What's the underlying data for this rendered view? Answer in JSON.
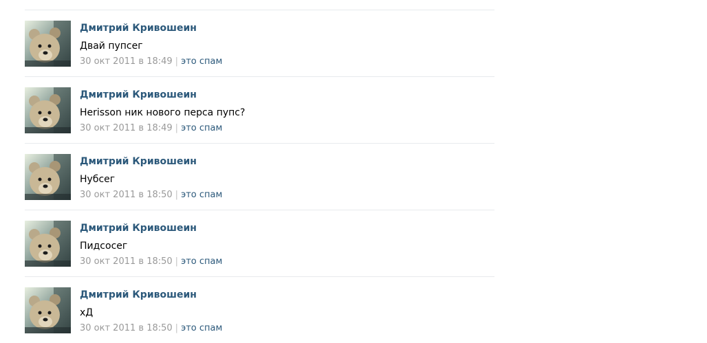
{
  "replies": [
    {
      "author": "Дмитрий Кривошеин",
      "text": "Двай пупсег",
      "date": "30 окт 2011 в 18:49",
      "separator": "|",
      "spam_label": "это спам"
    },
    {
      "author": "Дмитрий Кривошеин",
      "text": "Herisson ник нового перса пупс?",
      "date": "30 окт 2011 в 18:49",
      "separator": "|",
      "spam_label": "это спам"
    },
    {
      "author": "Дмитрий Кривошеин",
      "text": "Нубсег",
      "date": "30 окт 2011 в 18:50",
      "separator": "|",
      "spam_label": "это спам"
    },
    {
      "author": "Дмитрий Кривошеин",
      "text": "Пидсосег",
      "date": "30 окт 2011 в 18:50",
      "separator": "|",
      "spam_label": "это спам"
    },
    {
      "author": "Дмитрий Кривошеин",
      "text": "хД",
      "date": "30 окт 2011 в 18:50",
      "separator": "|",
      "spam_label": "это спам"
    }
  ],
  "colors": {
    "link": "#2b587a",
    "meta": "#999999",
    "divider": "#e7eaed",
    "text": "#000000"
  },
  "icons": {
    "avatar": "teddy-bear-avatar"
  }
}
